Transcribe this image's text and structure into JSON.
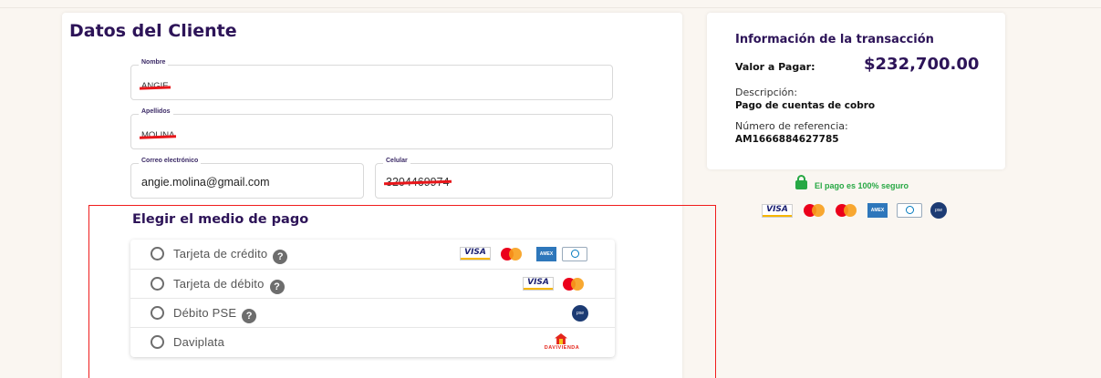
{
  "cliente": {
    "title": "Datos del Cliente",
    "nombre": {
      "label": "Nombre",
      "value": "ANGIE"
    },
    "apellidos": {
      "label": "Apellidos",
      "value": "MOLINA"
    },
    "correo": {
      "label": "Correo electrónico",
      "value": "angie.molina@gmail.com"
    },
    "celular": {
      "label": "Celular",
      "value": "3204469974"
    }
  },
  "pago": {
    "title": "Elegir el medio de pago",
    "methods": [
      {
        "label": "Tarjeta de crédito",
        "help": "?",
        "logos": [
          "visa-logo",
          "mastercard-logo",
          "amex-logo",
          "diners-club-logo"
        ]
      },
      {
        "label": "Tarjeta de débito",
        "help": "?",
        "logos": [
          "visa-logo",
          "mastercard-logo"
        ]
      },
      {
        "label": "Débito PSE",
        "help": "?",
        "logos": [
          "pse-logo"
        ]
      },
      {
        "label": "Daviplata",
        "logos": [
          "davivienda-logo"
        ]
      }
    ],
    "davivienda_text": "DAVIVIENDA",
    "pse_text": "pse"
  },
  "transaccion": {
    "title": "Información de la transacción",
    "valor_label": "Valor a Pagar:",
    "valor": "$232,700.00",
    "descripcion_label": "Descripción:",
    "descripcion": "Pago de cuentas de cobro",
    "referencia_label": "Número de referencia:",
    "referencia": "AM1666884627785"
  },
  "seguridad": {
    "text": "El pago es 100% seguro",
    "icon": "lock-icon"
  },
  "logos": {
    "visa_text": "VISA",
    "amex_text": "AMEX"
  },
  "colors": {
    "brand": "#2d1458",
    "secure": "#27a844",
    "highlight": "#f01c1c"
  }
}
